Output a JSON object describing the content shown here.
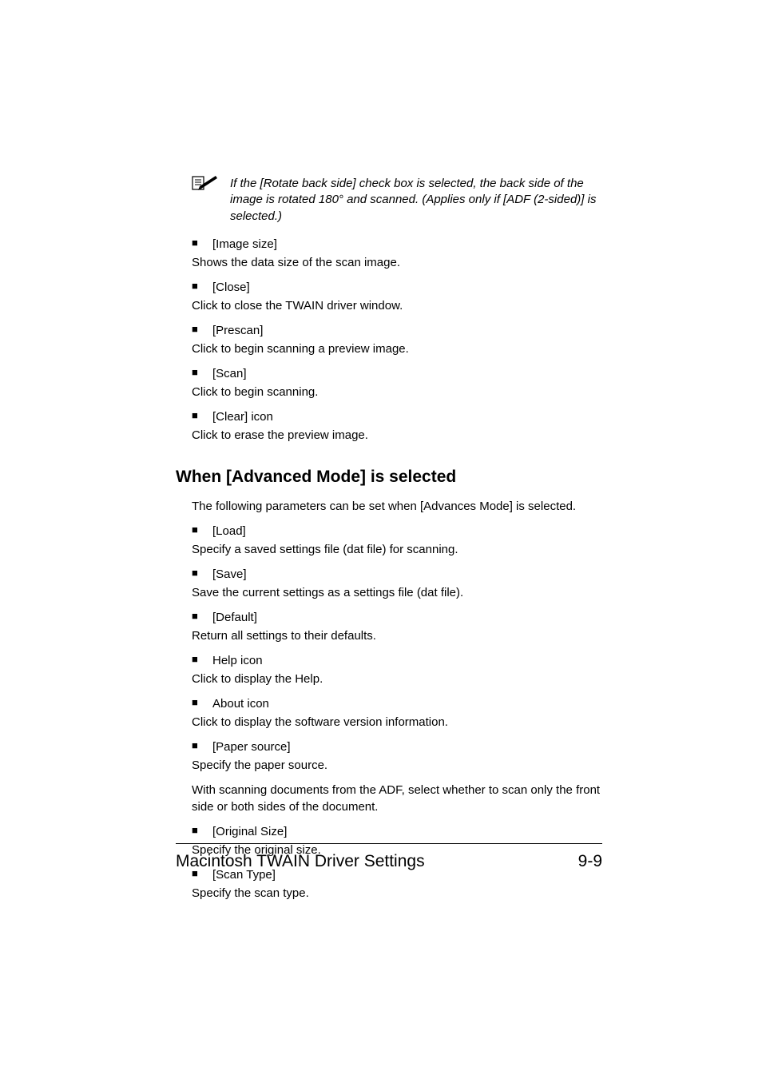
{
  "note": "If the [Rotate back side] check box is selected, the back side of the image is rotated 180° and scanned. (Applies only if [ADF (2-sided)] is selected.)",
  "items_top": [
    {
      "label": "[Image size]",
      "desc": "Shows the data size of the scan image."
    },
    {
      "label": "[Close]",
      "desc": "Click to close the TWAIN driver window."
    },
    {
      "label": "[Prescan]",
      "desc": "Click to begin scanning a preview image."
    },
    {
      "label": "[Scan]",
      "desc": "Click to begin scanning."
    },
    {
      "label": "[Clear] icon",
      "desc": "Click to erase the preview image."
    }
  ],
  "heading": "When [Advanced Mode] is selected",
  "intro": "The following parameters can be set when [Advances Mode] is selected.",
  "items_bottom": [
    {
      "label": "[Load]",
      "desc": "Specify a saved settings file (dat file) for scanning."
    },
    {
      "label": "[Save]",
      "desc": "Save the current settings as a settings file (dat file)."
    },
    {
      "label": "[Default]",
      "desc": "Return all settings to their defaults."
    },
    {
      "label": "Help icon",
      "desc": "Click to display the Help."
    },
    {
      "label": "About icon",
      "desc": "Click to display the software version information."
    },
    {
      "label": "[Paper source]",
      "desc": "Specify the paper source.",
      "desc2": "With scanning documents from the ADF, select whether to scan only the front side or both sides of the document."
    },
    {
      "label": "[Original Size]",
      "desc": "Specify the original size."
    },
    {
      "label": "[Scan Type]",
      "desc": "Specify the scan type."
    }
  ],
  "footer_title": "Macintosh TWAIN Driver Settings",
  "footer_page": "9-9"
}
